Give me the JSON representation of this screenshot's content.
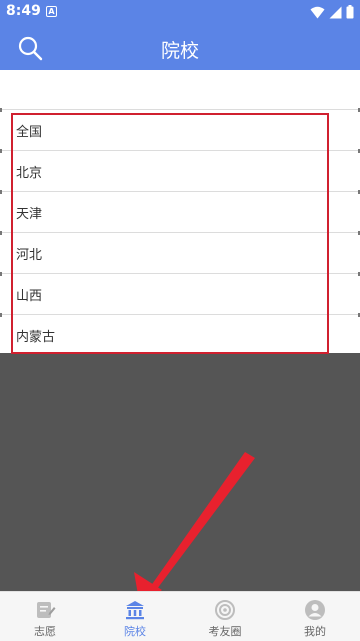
{
  "status": {
    "time": "8:49",
    "a_badge": "A"
  },
  "header": {
    "title": "院校",
    "search_icon": "search-icon"
  },
  "list": {
    "items": [
      {
        "label": "全国"
      },
      {
        "label": "北京"
      },
      {
        "label": "天津"
      },
      {
        "label": "河北"
      },
      {
        "label": "山西"
      },
      {
        "label": "内蒙古"
      }
    ]
  },
  "tabs": [
    {
      "label": "志愿",
      "icon": "form-edit-icon",
      "active": false
    },
    {
      "label": "院校",
      "icon": "institution-icon",
      "active": true
    },
    {
      "label": "考友圈",
      "icon": "target-circle-icon",
      "active": false
    },
    {
      "label": "我的",
      "icon": "user-icon",
      "active": false
    }
  ],
  "colors": {
    "primary": "#5b84e6",
    "highlight": "#d0202f",
    "overlay": "#555555"
  }
}
